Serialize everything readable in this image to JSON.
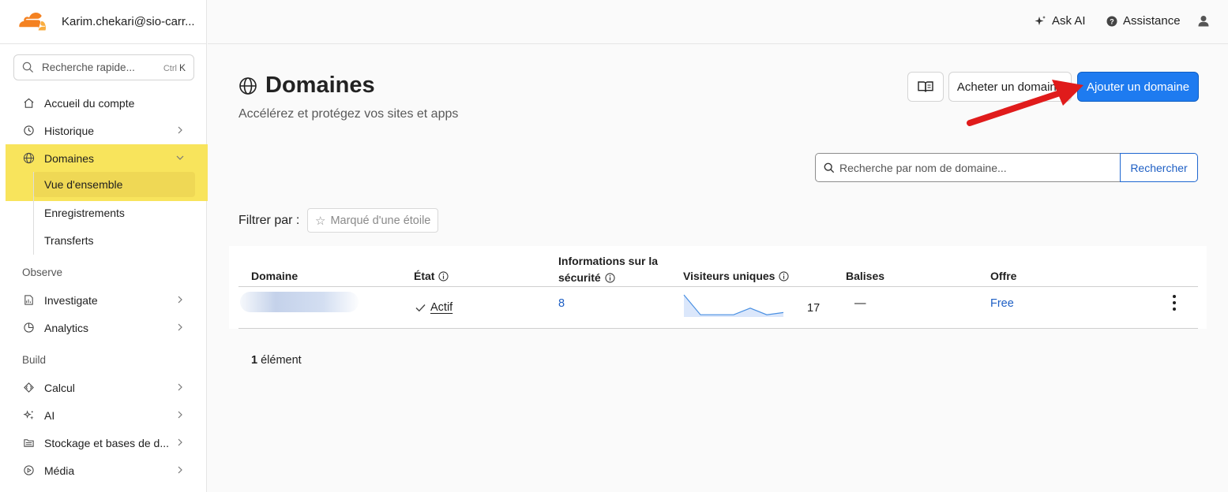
{
  "account": {
    "email": "Karim.chekari@sio-carr..."
  },
  "sidebar": {
    "search_placeholder": "Recherche rapide...",
    "search_shortcut_mod": "Ctrl",
    "search_shortcut_key": "K",
    "items": [
      {
        "label": "Accueil du compte",
        "icon": "home-icon"
      },
      {
        "label": "Historique",
        "icon": "history-icon"
      },
      {
        "label": "Domaines",
        "icon": "globe-icon",
        "expanded": true,
        "children": [
          {
            "label": "Vue d'ensemble",
            "active": true
          },
          {
            "label": "Enregistrements"
          },
          {
            "label": "Transferts"
          }
        ]
      }
    ],
    "section_observe": "Observe",
    "observe_items": [
      {
        "label": "Investigate",
        "icon": "investigate-icon"
      },
      {
        "label": "Analytics",
        "icon": "analytics-icon"
      }
    ],
    "section_build": "Build",
    "build_items": [
      {
        "label": "Calcul",
        "icon": "compute-icon"
      },
      {
        "label": "AI",
        "icon": "sparkle-icon"
      },
      {
        "label": "Stockage et bases de d...",
        "icon": "storage-icon"
      },
      {
        "label": "Média",
        "icon": "media-icon"
      }
    ]
  },
  "topbar": {
    "ask_ai": "Ask AI",
    "assistance": "Assistance"
  },
  "header": {
    "title": "Domaines",
    "subtitle": "Accélérez et protégez vos sites et apps",
    "buy_label": "Acheter un domaine",
    "add_label": "Ajouter un domaine"
  },
  "search": {
    "placeholder": "Recherche par nom de domaine...",
    "button": "Rechercher"
  },
  "filter": {
    "label": "Filtrer par :",
    "chip": "Marqué d'une étoile"
  },
  "table": {
    "headers": {
      "domain": "Domaine",
      "state": "État",
      "security_line1": "Informations sur la",
      "security_line2": "sécurité",
      "visitors": "Visiteurs uniques",
      "tags": "Balises",
      "plan": "Offre"
    },
    "rows": [
      {
        "state": "Actif",
        "security": "8",
        "visitors": "17",
        "visitors_trend": [
          10,
          1,
          1,
          1,
          4,
          1,
          2
        ],
        "tags": "—",
        "plan": "Free"
      }
    ]
  },
  "footer": {
    "count": "1",
    "count_label": "élément"
  },
  "colors": {
    "accent": "#1e7bf0",
    "highlight": "#f8e45c",
    "arrow": "#e01b1b"
  }
}
